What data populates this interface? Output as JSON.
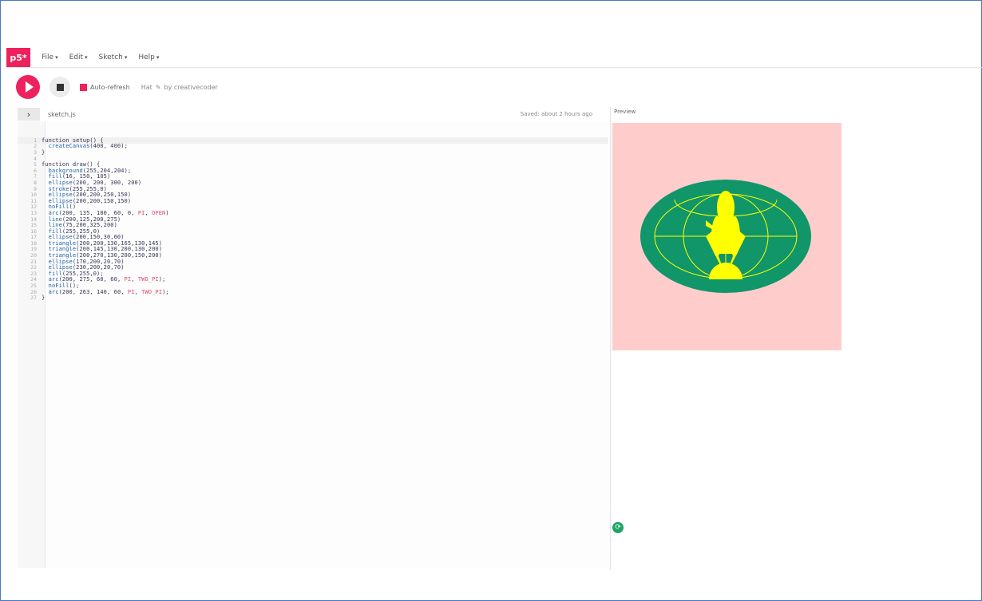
{
  "app": {
    "logo": "p5*"
  },
  "menu": {
    "items": [
      {
        "label": "File"
      },
      {
        "label": "Edit"
      },
      {
        "label": "Sketch"
      },
      {
        "label": "Help"
      }
    ]
  },
  "toolbar": {
    "auto_refresh_label": "Auto-refresh",
    "sketch_name": "Hat",
    "byline": "by creativecoder"
  },
  "editor": {
    "filename": "sketch.js",
    "saved_status": "Saved: about 2 hours ago",
    "lines": [
      "function setup() {",
      "  createCanvas(400, 400);",
      "}",
      "",
      "function draw() {",
      "  background(255,204,204);",
      "  fill(16, 150, 105)",
      "  ellipse(200, 200, 300, 200)",
      "  stroke(255,255,0)",
      "  ellipse(200,200,250,150)",
      "  ellipse(200,200,150,150)",
      "  noFill()",
      "  arc(200, 135, 180, 60, 0, PI, OPEN)",
      "  line(200,125,200,275)",
      "  line(75,200,325,200)",
      "  fill(255,255,0)",
      "  ellipse(200,150,30,60)",
      "  triangle(200,200,130,165,130,145)",
      "  triangle(200,145,130,200,130,200)",
      "  triangle(200,270,130,200,150,200)",
      "  ellipse(170,200,20,70)",
      "  ellipse(230,200,20,70)",
      "  fill(255,255,0);",
      "  arc(200, 275, 60, 60, PI, TWO_PI);",
      "  noFill();",
      "  arc(200, 263, 140, 60, PI, TWO_PI);",
      "}"
    ]
  },
  "preview": {
    "label": "Preview",
    "background_color": "#FFCCCC",
    "ellipse_color": "#109669",
    "accent_color": "#FFFF00"
  },
  "colors": {
    "brand": "#ED225D",
    "keyword": "#1C5EA8",
    "pi_constant": "#E0466A"
  }
}
